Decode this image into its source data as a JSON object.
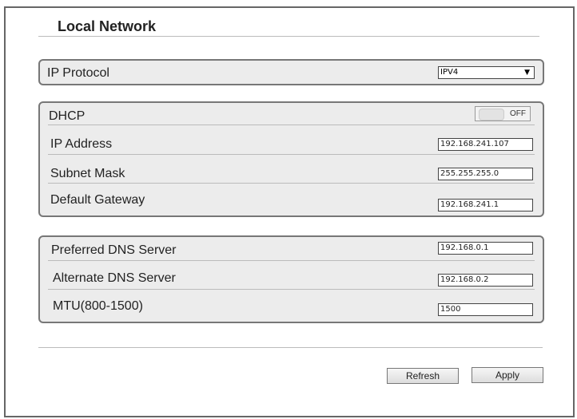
{
  "title": "Local Network",
  "ip_protocol": {
    "label": "IP Protocol",
    "value": "IPV4"
  },
  "dhcp": {
    "label": "DHCP",
    "toggle": "OFF"
  },
  "ip_address": {
    "label": "IP Address",
    "value": "192.168.241.107"
  },
  "subnet_mask": {
    "label": "Subnet Mask",
    "value": "255.255.255.0"
  },
  "default_gateway": {
    "label": "Default Gateway",
    "value": "192.168.241.1"
  },
  "preferred_dns": {
    "label": "Preferred DNS Server",
    "value": "192.168.0.1"
  },
  "alternate_dns": {
    "label": "Alternate DNS Server",
    "value": "192.168.0.2"
  },
  "mtu": {
    "label": "MTU(800-1500)",
    "value": "1500"
  },
  "buttons": {
    "refresh": "Refresh",
    "apply": "Apply"
  }
}
